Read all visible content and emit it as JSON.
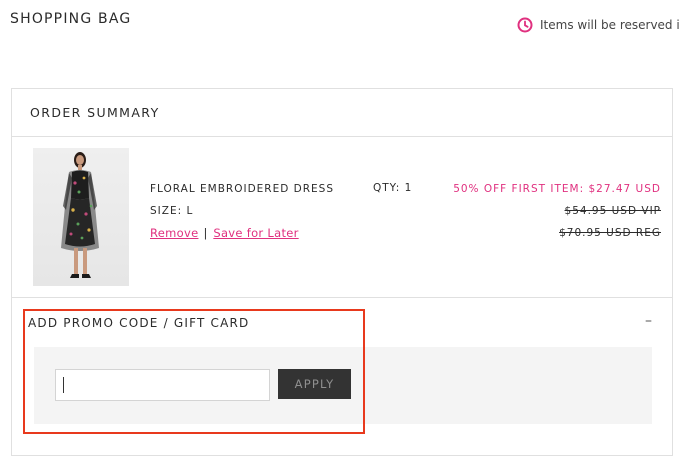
{
  "header": {
    "title": "SHOPPING BAG",
    "reserve_notice": "Items will be reserved i"
  },
  "summary": {
    "title": "ORDER SUMMARY"
  },
  "item": {
    "name": "FLORAL EMBROIDERED DRESS",
    "size": "SIZE: L",
    "qty": "QTY: 1",
    "sale_price": "50% OFF FIRST ITEM: $27.47 USD",
    "vip_price": "$54.95 USD VIP",
    "reg_price": "$70.95 USD REG",
    "remove_label": "Remove",
    "separator": "|",
    "save_later_label": "Save for Later"
  },
  "promo": {
    "title": "ADD PROMO CODE / GIFT CARD",
    "toggle": "–",
    "input_value": "",
    "input_placeholder": "",
    "apply_label": "APPLY"
  },
  "colors": {
    "accent_pink": "#e0307f",
    "button_dark": "#333333",
    "highlight_red": "#e8391d"
  },
  "icons": {
    "clock": "clock-icon"
  }
}
